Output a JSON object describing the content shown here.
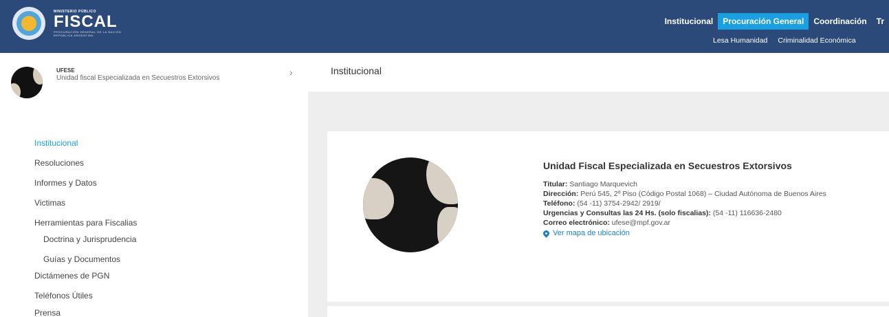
{
  "header": {
    "logo_top": "MINISTERIO PÚBLICO",
    "logo_name": "FISCAL",
    "logo_sub1": "PROCURACIÓN GENERAL DE LA NACIÓN",
    "logo_sub2": "REPÚBLICA ARGENTINA",
    "nav": [
      {
        "label": "Institucional",
        "active": false
      },
      {
        "label": "Procuración General",
        "active": true
      },
      {
        "label": "Coordinación",
        "active": false
      },
      {
        "label": "Tr",
        "active": false
      }
    ],
    "subnav": [
      "Lesa Humanidad",
      "Criminalidad Económica"
    ],
    "colors": {
      "bar": "#2b4a79",
      "active": "#1aa0e0"
    }
  },
  "sidebar": {
    "unit_code": "UFESE",
    "unit_name": "Unidad fiscal Especializada en Secuestros Extorsivos",
    "chevron": "›",
    "menu": [
      {
        "label": "Institucional",
        "active": true,
        "sub": false
      },
      {
        "label": "Resoluciones",
        "active": false,
        "sub": false
      },
      {
        "label": "Informes y Datos",
        "active": false,
        "sub": false
      },
      {
        "label": "Victimas",
        "active": false,
        "sub": false
      },
      {
        "label": "Herramientas para Fiscalias",
        "active": false,
        "sub": false
      },
      {
        "label": "Doctrina y Jurisprudencia",
        "active": false,
        "sub": true
      },
      {
        "label": "Guías y Documentos",
        "active": false,
        "sub": true
      },
      {
        "label": "Dictámenes de PGN",
        "active": false,
        "sub": false
      },
      {
        "label": "Teléfonos Útiles",
        "active": false,
        "sub": false
      },
      {
        "label": "Prensa",
        "active": false,
        "sub": false
      }
    ]
  },
  "main": {
    "title": "Institucional",
    "card": {
      "title": "Unidad Fiscal Especializada en Secuestros Extorsivos",
      "titular_label": "Titular:",
      "titular_value": " Santiago Marquevich",
      "direccion_label": "Dirección:",
      "direccion_value": " Perú 545, 2º Piso (Código Postal 1068) – Ciudad Autónoma de Buenos Aires",
      "telefono_label": "Teléfono:",
      "telefono_value": " (54 -11) 3754-2942/ 2919/",
      "urgencias_label": "Urgencias y Consultas las 24 Hs. (solo fiscalias):",
      "urgencias_value": " (54 -11) 116636-2480",
      "correo_label": "Correo electrónico:",
      "correo_value": " ufese@mpf.gov.ar",
      "map_link": "Ver mapa de ubicación",
      "map_icon": "map-pin-icon"
    }
  }
}
